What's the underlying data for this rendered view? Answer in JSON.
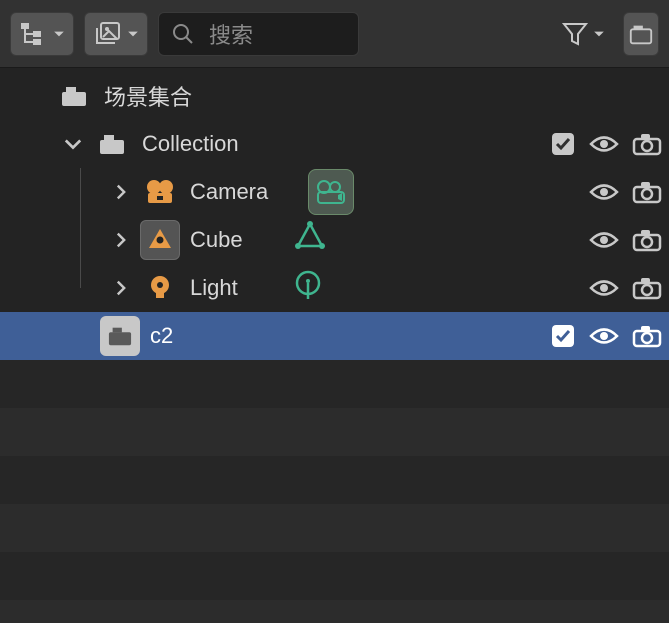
{
  "search": {
    "placeholder": "搜索"
  },
  "root": {
    "label": "场景集合"
  },
  "collection": {
    "label": "Collection"
  },
  "items": {
    "camera": "Camera",
    "cube": "Cube",
    "light": "Light"
  },
  "c2": {
    "label": "c2"
  },
  "colors": {
    "orange": "#e79a46",
    "teal": "#3fb58f",
    "grey": "#c8c8c8"
  }
}
